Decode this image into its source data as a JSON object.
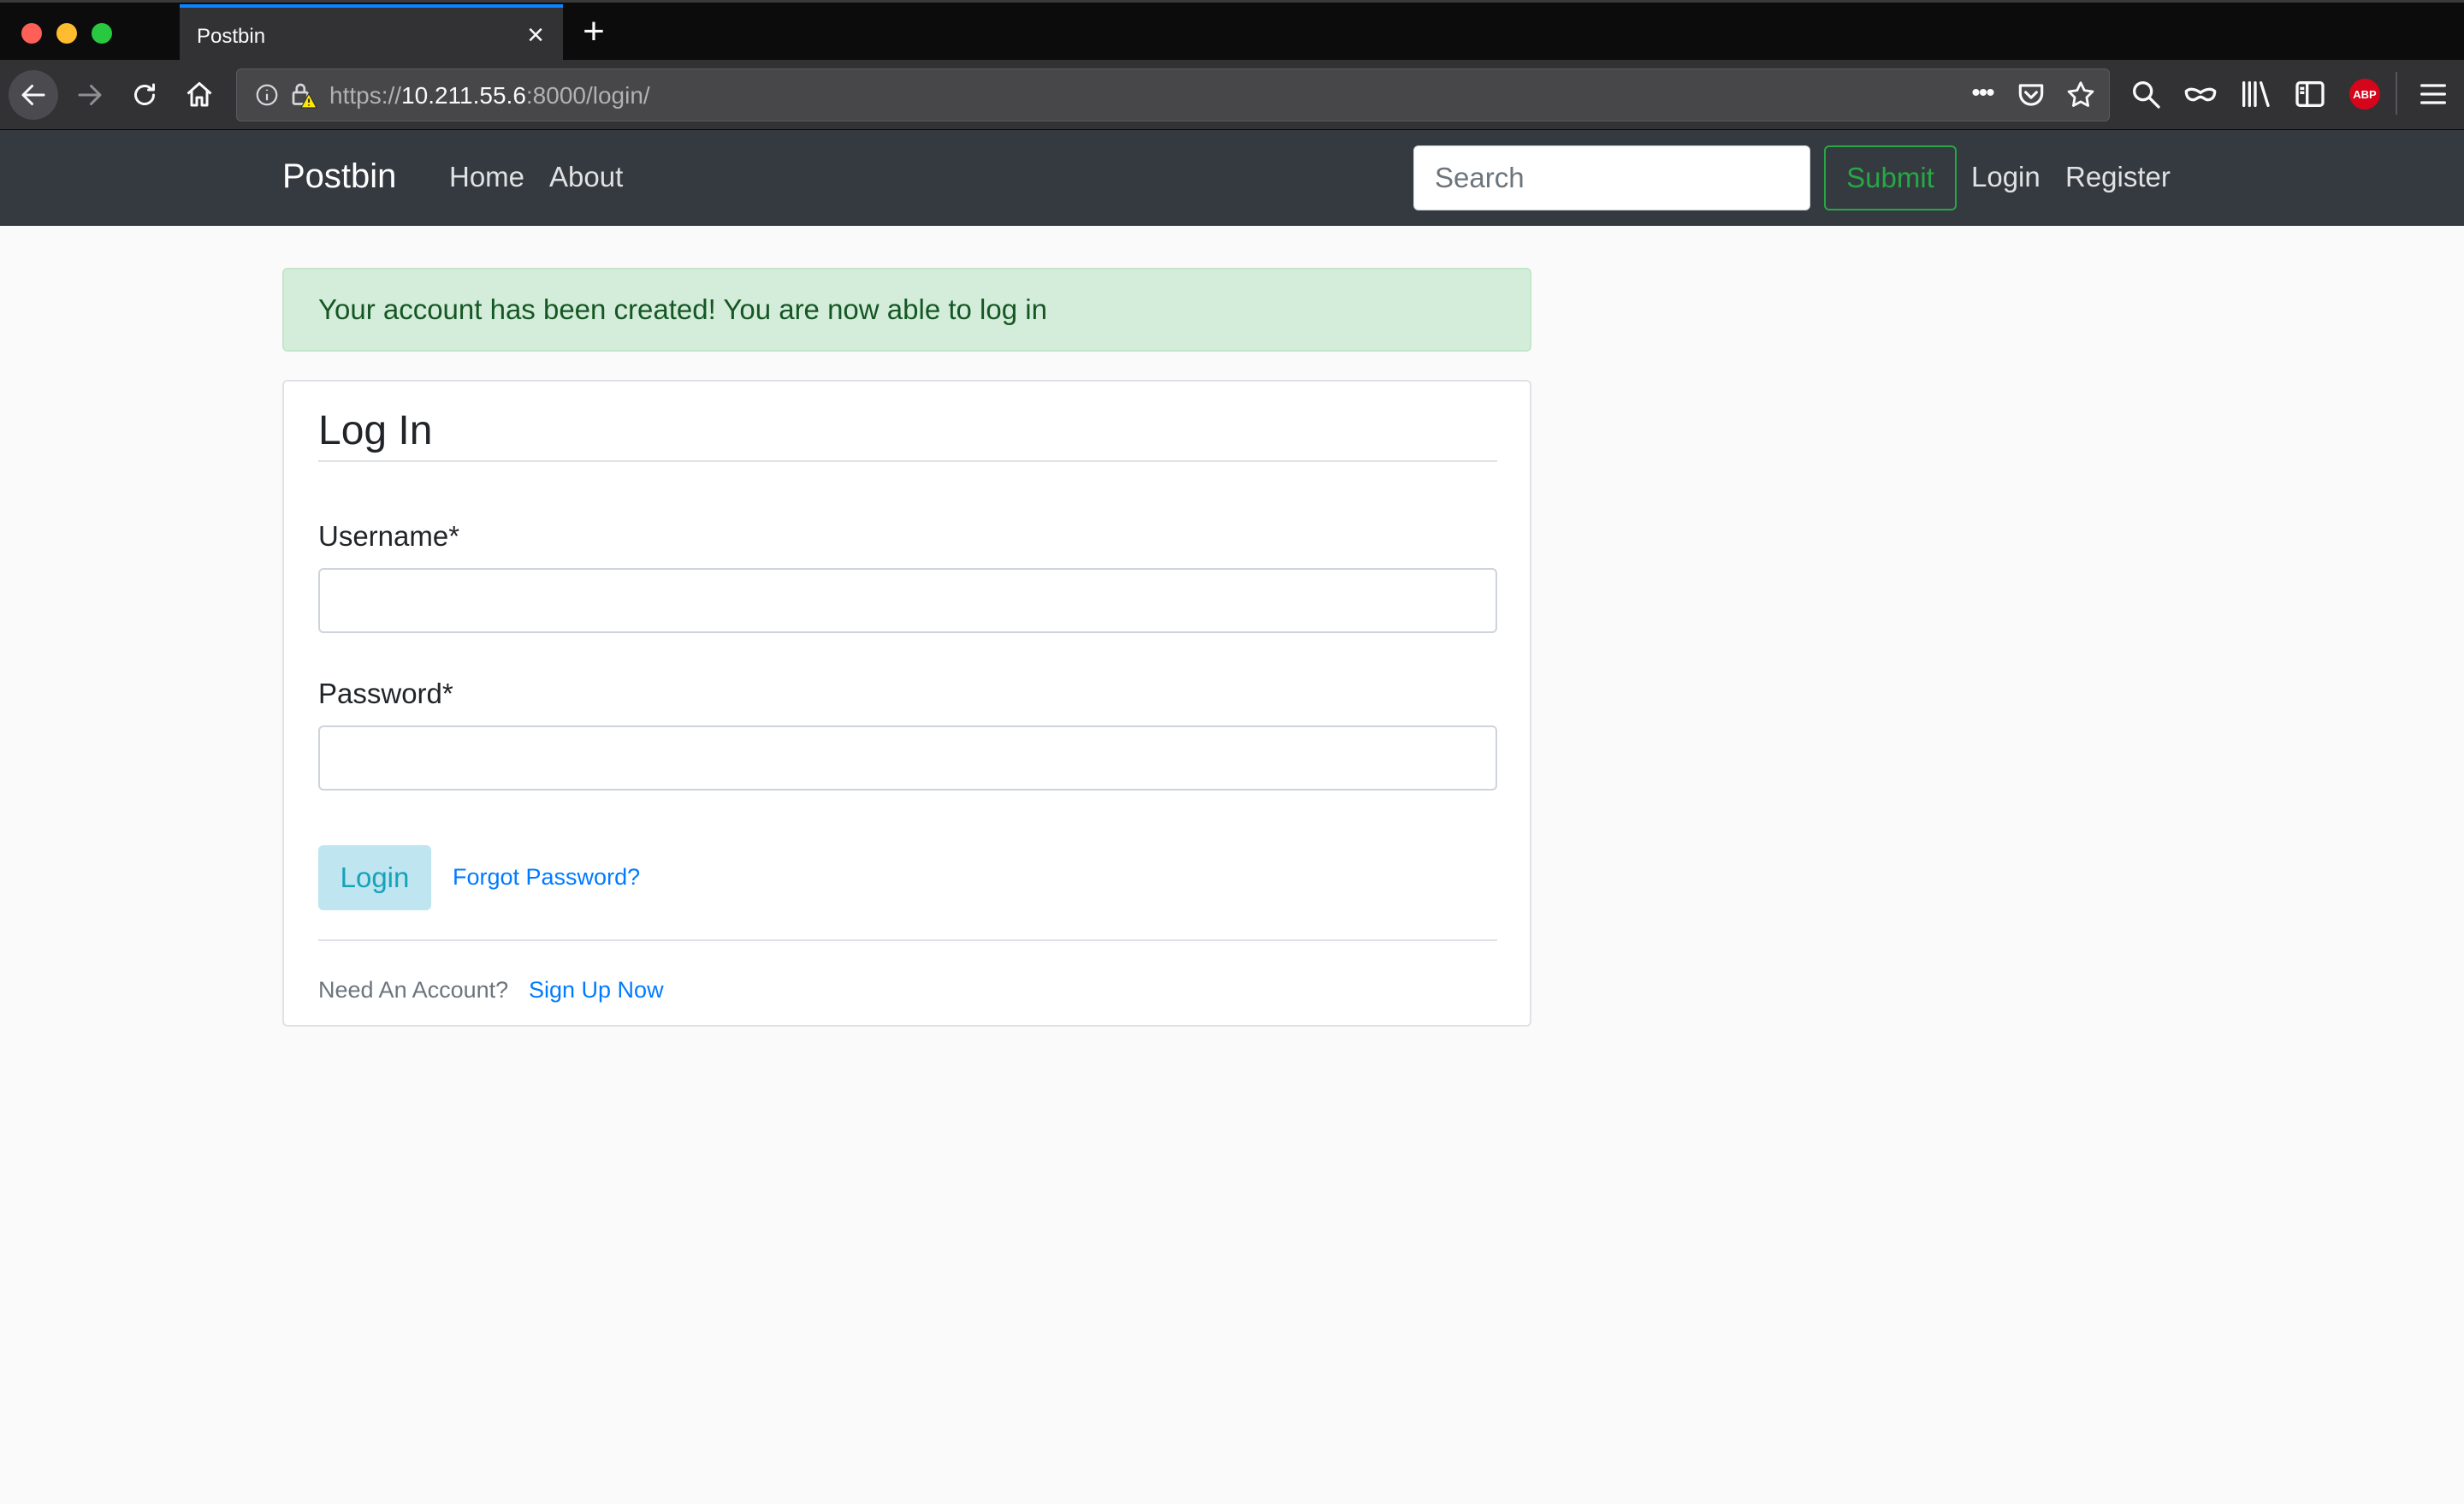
{
  "browser": {
    "tab_title": "Postbin",
    "url_scheme": "https://",
    "url_host": "10.211.55.6",
    "url_rest": ":8000/login/",
    "icons": [
      "back-icon",
      "forward-icon",
      "reload-icon",
      "home-icon",
      "info-icon",
      "insecure-lock-icon",
      "more-icon",
      "pocket-icon",
      "star-icon",
      "search-icon",
      "private-mask-icon",
      "library-icon",
      "sidebar-icon",
      "adblock-icon",
      "hamburger-menu-icon"
    ],
    "abp_label": "ABP"
  },
  "navbar": {
    "brand": "Postbin",
    "links": [
      "Home",
      "About"
    ],
    "search_placeholder": "Search",
    "submit_label": "Submit",
    "login_label": "Login",
    "register_label": "Register",
    "colors": {
      "background": "#343a40",
      "submit": "#28a745"
    }
  },
  "alert": {
    "message": "Your account has been created! You are now able to log in",
    "colors": {
      "background": "#d4edda",
      "text": "#155724"
    }
  },
  "form": {
    "title": "Log In",
    "username_label": "Username*",
    "username_value": "",
    "password_label": "Password*",
    "password_value": "",
    "login_button": "Login",
    "forgot_link": "Forgot Password?",
    "need_account": "Need An Account?",
    "signup_link": "Sign Up Now",
    "colors": {
      "link": "#007bff",
      "login_button_text": "#17a2b8"
    }
  }
}
